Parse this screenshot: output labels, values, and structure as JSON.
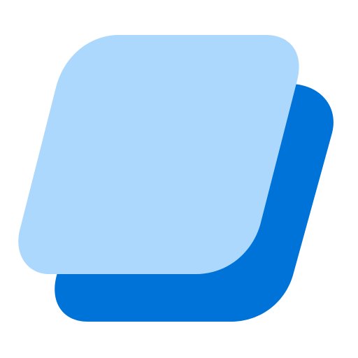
{
  "icon": {
    "name": "stacked-parallelograms-icon",
    "colors": {
      "background": "#ffffff",
      "back_shape": "#0073d9",
      "front_shape": "#acd8fd"
    }
  }
}
